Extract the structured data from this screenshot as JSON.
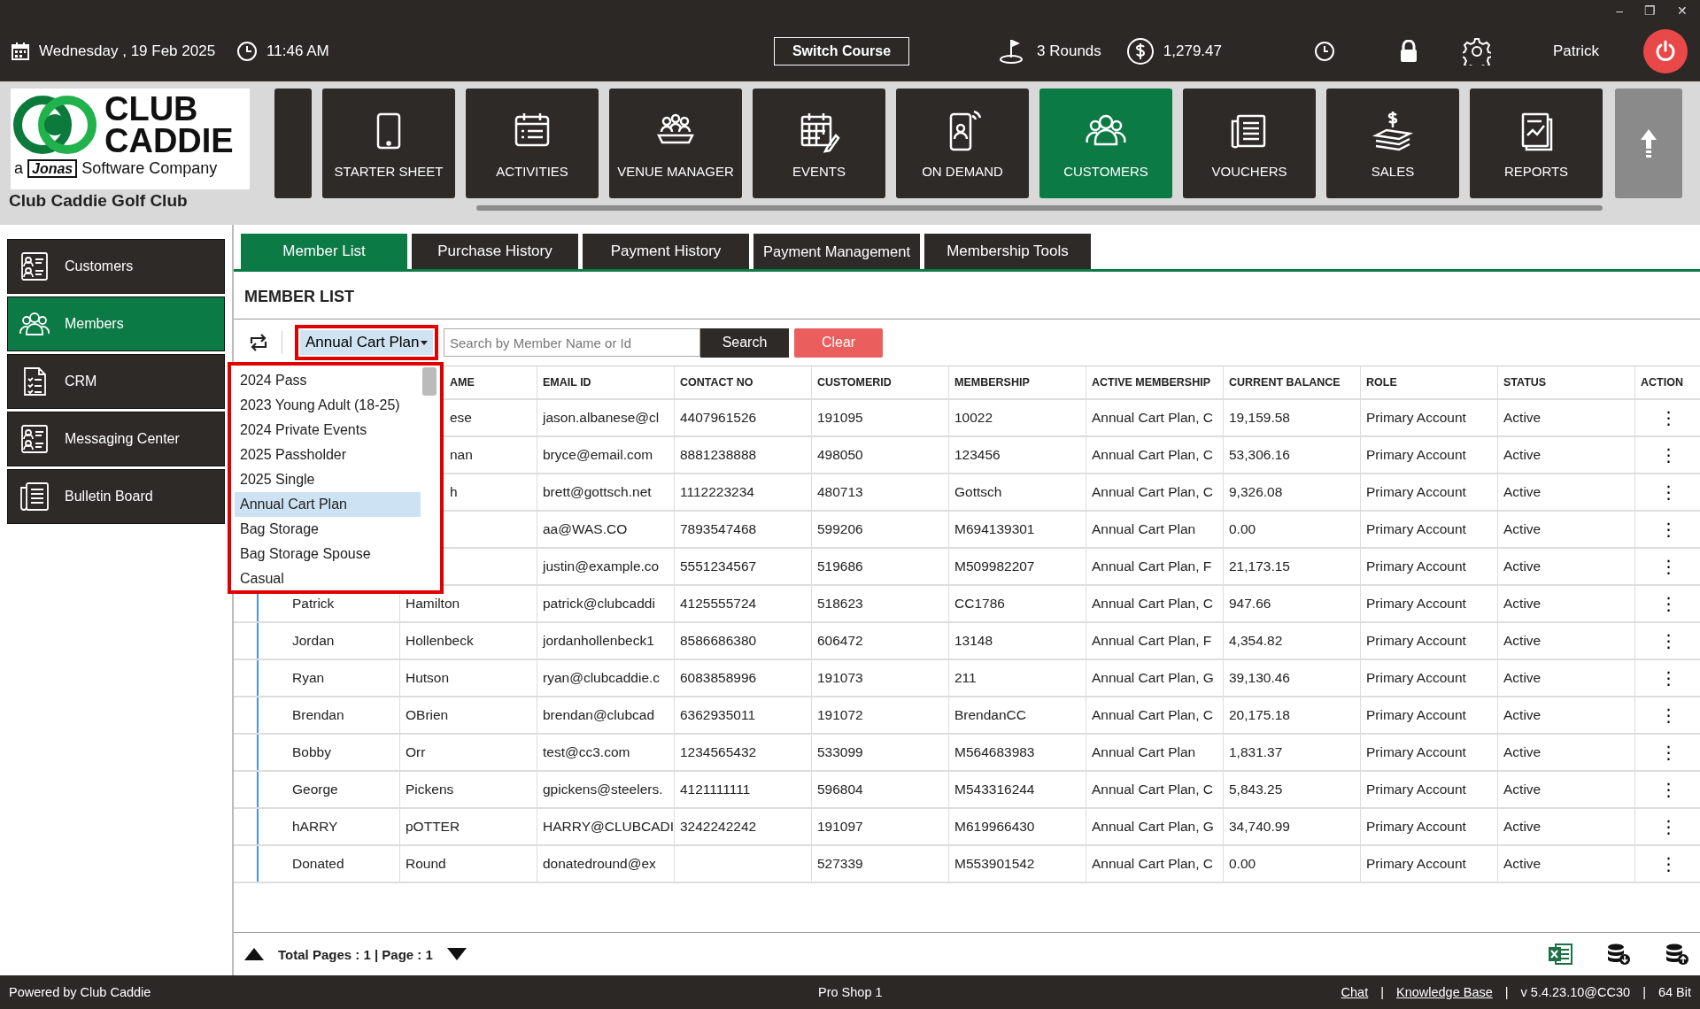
{
  "window_controls": [
    "–",
    "❐",
    "✕"
  ],
  "top_bar": {
    "date": "Wednesday ,  19 Feb 2025",
    "time": "11:46 AM",
    "switch_course": "Switch Course",
    "rounds": "3 Rounds",
    "balance": "1,279.47",
    "user": "Patrick"
  },
  "logo": {
    "line1": "CLUB",
    "line2": "CADDIE",
    "prefix": "a",
    "brand": "Jonas",
    "suffix": "Software Company",
    "club_name": "Club Caddie Golf Club"
  },
  "nav_tiles": [
    {
      "label": "STARTER SHEET",
      "kind": "tablet",
      "selected": false
    },
    {
      "label": "ACTIVITIES",
      "kind": "list",
      "selected": false
    },
    {
      "label": "VENUE MANAGER",
      "kind": "meeting",
      "selected": false
    },
    {
      "label": "EVENTS",
      "kind": "calendar",
      "selected": false
    },
    {
      "label": "ON DEMAND",
      "kind": "phone",
      "selected": false
    },
    {
      "label": "CUSTOMERS",
      "kind": "people",
      "selected": true
    },
    {
      "label": "VOUCHERS",
      "kind": "document",
      "selected": false
    },
    {
      "label": "SALES",
      "kind": "money",
      "selected": false
    },
    {
      "label": "REPORTS",
      "kind": "report",
      "selected": false
    }
  ],
  "sidebar": {
    "items": [
      {
        "label": "Customers",
        "kind": "card",
        "selected": false
      },
      {
        "label": "Members",
        "kind": "people",
        "selected": true
      },
      {
        "label": "CRM",
        "kind": "checklist",
        "selected": false
      },
      {
        "label": "Messaging Center",
        "kind": "card",
        "selected": false
      },
      {
        "label": "Bulletin Board",
        "kind": "news",
        "selected": false
      }
    ]
  },
  "tabs": [
    {
      "label": "Member List",
      "selected": true
    },
    {
      "label": "Purchase History",
      "selected": false
    },
    {
      "label": "Payment History",
      "selected": false
    },
    {
      "label": "Payment Management",
      "selected": false
    },
    {
      "label": "Membership Tools",
      "selected": false
    }
  ],
  "section_title": "MEMBER LIST",
  "filter": {
    "value": "Annual Cart Plan",
    "expanded": true,
    "options": [
      {
        "label": "2024 Pass",
        "selected": false
      },
      {
        "label": "2023 Young Adult (18-25)",
        "selected": false
      },
      {
        "label": "2024 Private Events",
        "selected": false
      },
      {
        "label": "2025 Passholder",
        "selected": false
      },
      {
        "label": "2025 Single",
        "selected": false
      },
      {
        "label": "Annual Cart Plan",
        "selected": true
      },
      {
        "label": "Bag Storage",
        "selected": false
      },
      {
        "label": "Bag Storage Spouse",
        "selected": false
      },
      {
        "label": "Casual",
        "selected": false
      }
    ]
  },
  "search": {
    "placeholder": "Search by Member Name or Id",
    "button": "Search",
    "clear": "Clear"
  },
  "table": {
    "columns": [
      "AME",
      "EMAIL ID",
      "CONTACT NO",
      "CUSTOMERID",
      "MEMBERSHIP",
      "ACTIVE MEMBERSHIP",
      "CURRENT BALANCE",
      "ROLE",
      "STATUS",
      "ACTION"
    ],
    "rows": [
      {
        "last_name": "ese",
        "email": "jason.albanese@cl",
        "contact": "4407961526",
        "customer_id": "191095",
        "membership": "10022",
        "active_membership": "Annual Cart Plan, C",
        "balance": "19,159.58",
        "role": "Primary Account",
        "status": "Active",
        "action": "⋮"
      },
      {
        "last_name": "nan",
        "email": "bryce@email.com",
        "contact": "8881238888",
        "customer_id": "498050",
        "membership": "123456",
        "active_membership": "Annual Cart Plan, C",
        "balance": "53,306.16",
        "role": "Primary Account",
        "status": "Active",
        "action": "⋮"
      },
      {
        "last_name": "h",
        "email": "brett@gottsch.net",
        "contact": "1112223234",
        "customer_id": "480713",
        "membership": "Gottsch",
        "active_membership": "Annual Cart Plan, C",
        "balance": "9,326.08",
        "role": "Primary Account",
        "status": "Active",
        "action": "⋮"
      },
      {
        "email": "aa@WAS.CO",
        "contact": "7893547468",
        "customer_id": "599206",
        "membership": "M694139301",
        "active_membership": "Annual Cart Plan",
        "balance": "0.00",
        "role": "Primary Account",
        "status": "Active",
        "action": "⋮"
      },
      {
        "email": "justin@example.co",
        "contact": "5551234567",
        "customer_id": "519686",
        "membership": "M509982207",
        "active_membership": "Annual Cart Plan, F",
        "balance": "21,173.15",
        "role": "Primary Account",
        "status": "Active",
        "action": "⋮"
      },
      {
        "first_name": "Patrick",
        "last_name": "Hamilton",
        "email": "patrick@clubcaddi",
        "contact": "4125555724",
        "customer_id": "518623",
        "membership": "CC1786",
        "active_membership": "Annual Cart Plan, C",
        "balance": "947.66",
        "role": "Primary Account",
        "status": "Active",
        "action": "⋮"
      },
      {
        "first_name": "Jordan",
        "last_name": "Hollenbeck",
        "email": "jordanhollenbeck1",
        "contact": "8586686380",
        "customer_id": "606472",
        "membership": "13148",
        "active_membership": "Annual Cart Plan, F",
        "balance": "4,354.82",
        "role": "Primary Account",
        "status": "Active",
        "action": "⋮"
      },
      {
        "first_name": "Ryan",
        "last_name": "Hutson",
        "email": "ryan@clubcaddie.c",
        "contact": "6083858996",
        "customer_id": "191073",
        "membership": "211",
        "active_membership": "Annual Cart Plan, G",
        "balance": "39,130.46",
        "role": "Primary Account",
        "status": "Active",
        "action": "⋮"
      },
      {
        "first_name": "Brendan",
        "last_name": "OBrien",
        "email": "brendan@clubcad",
        "contact": "6362935011",
        "customer_id": "191072",
        "membership": "BrendanCC",
        "active_membership": "Annual Cart Plan, C",
        "balance": "20,175.18",
        "role": "Primary Account",
        "status": "Active",
        "action": "⋮"
      },
      {
        "first_name": "Bobby",
        "last_name": "Orr",
        "email": "test@cc3.com",
        "contact": "1234565432",
        "customer_id": "533099",
        "membership": "M564683983",
        "active_membership": "Annual Cart Plan",
        "balance": "1,831.37",
        "role": "Primary Account",
        "status": "Active",
        "action": "⋮"
      },
      {
        "first_name": "George",
        "last_name": "Pickens",
        "email": "gpickens@steelers.",
        "contact": "4121111111",
        "customer_id": "596804",
        "membership": "M543316244",
        "active_membership": "Annual Cart Plan, C",
        "balance": "5,843.25",
        "role": "Primary Account",
        "status": "Active",
        "action": "⋮"
      },
      {
        "first_name": "hARRY",
        "last_name": "pOTTER",
        "email": "HARRY@CLUBCADI",
        "contact": "3242242242",
        "customer_id": "191097",
        "membership": "M619966430",
        "active_membership": "Annual Cart Plan, G",
        "balance": "34,740.99",
        "role": "Primary Account",
        "status": "Active",
        "action": "⋮"
      },
      {
        "first_name": "Donated",
        "last_name": "Round",
        "email": "donatedround@ex",
        "customer_id": "527339",
        "membership": "M553901542",
        "active_membership": "Annual Cart Plan, C",
        "balance": "0.00",
        "role": "Primary Account",
        "status": "Active",
        "action": "⋮"
      }
    ]
  },
  "pagination": "Total Pages : 1 | Page : 1",
  "status_bar": {
    "left": "Powered by Club Caddie",
    "center": "Pro Shop 1",
    "chat": "Chat",
    "knowledge_base": "Knowledge Base",
    "version": "v 5.4.23.10@CC30",
    "bits": "64 Bit",
    "separators": [
      "|",
      "|",
      "|"
    ]
  }
}
